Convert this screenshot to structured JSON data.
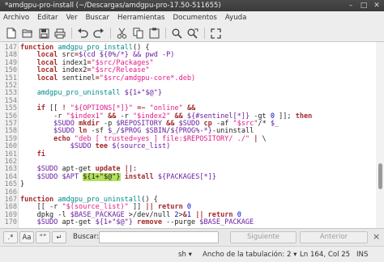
{
  "window": {
    "title": "*amdgpu-pro-install (~/Descargas/amdgpu-pro-17.50-511655)"
  },
  "menu": [
    "Archivo",
    "Editar",
    "Ver",
    "Buscar",
    "Herramientas",
    "Documentos",
    "Ayuda"
  ],
  "toolbar_icons": [
    "new-file-icon",
    "open-icon",
    "save-icon",
    "print-icon",
    "undo-icon",
    "redo-icon",
    "cut-icon",
    "copy-icon",
    "paste-icon",
    "search-icon",
    "replace-icon",
    "fullscreen-icon"
  ],
  "code": {
    "lines": [
      {
        "n": "147",
        "t": "function amdgpu_pro_install() {"
      },
      {
        "n": "148",
        "t": "    local src=$(cd ${0%/*} && pwd -P)"
      },
      {
        "n": "149",
        "t": "    local index1=\"$src/Packages\""
      },
      {
        "n": "150",
        "t": "    local index2=\"$src/Release\""
      },
      {
        "n": "151",
        "t": "    local sentinel=\"$src/amdgpu-core*.deb)"
      },
      {
        "n": "152",
        "t": ""
      },
      {
        "n": "153",
        "t": "    amdgpu_pro_uninstall ${1+\"$@\"}"
      },
      {
        "n": "154",
        "t": ""
      },
      {
        "n": "155",
        "t": "    if [[ ! \"${OPTIONS[*]}\" =~ \"online\" &&"
      },
      {
        "n": "156",
        "t": "        -r \"$index1\" && -r \"$index2\" && ${#sentinel[*]} -gt 0 ]]; then"
      },
      {
        "n": "157",
        "t": "        $SUDO mkdir -p $REPOSITORY && $SUDO cp -af \"$src\"/* $_"
      },
      {
        "n": "158",
        "t": "        $SUDO ln -sf $_/$PROG $SBIN/${PROG%-*}-uninstall"
      },
      {
        "n": "159",
        "t": "        echo \"deb [ trusted=yes ] file:$REPOSITORY/ ./\" | \\"
      },
      {
        "n": "160",
        "t": "            $SUDO tee $(source_list)"
      },
      {
        "n": "161",
        "t": "    fi"
      },
      {
        "n": "162",
        "t": ""
      },
      {
        "n": "163",
        "t": "    $SUDO apt-get update ||:"
      },
      {
        "n": "164",
        "t": "    $SUDO $APT ${1+\"$@\"} install ${PACKAGES[*]}"
      },
      {
        "n": "165",
        "t": "}"
      },
      {
        "n": "166",
        "t": ""
      },
      {
        "n": "167",
        "t": "function amdgpu_pro_uninstall() {"
      },
      {
        "n": "168",
        "t": "    [[ -r \"$(source_list)\" ]] || return 0"
      },
      {
        "n": "169",
        "t": "    dpkg -l $BASE_PACKAGE >/dev/null 2>&1 || return 0"
      },
      {
        "n": "170",
        "t": "    $SUDO apt-get ${1+\"$@\"} remove --purge $BASE_PACKAGE"
      }
    ],
    "selected_line": "164",
    "selected_text": "${1+\"$@\"}"
  },
  "findbar": {
    "icons": [
      "regex-toggle-icon",
      "match-case-icon",
      "whole-word-icon",
      "wrap-around-icon"
    ],
    "icon_labels": [
      ".*",
      "Aa",
      "“”",
      "↵"
    ],
    "label": "Buscar:",
    "placeholder": "",
    "next": "Siguiente",
    "prev": "Anterior",
    "close": "×"
  },
  "status": {
    "lang": "sh",
    "tab": "Ancho de la tabulación: 2",
    "position": "Ln 164, Col 25",
    "mode": "INS"
  }
}
